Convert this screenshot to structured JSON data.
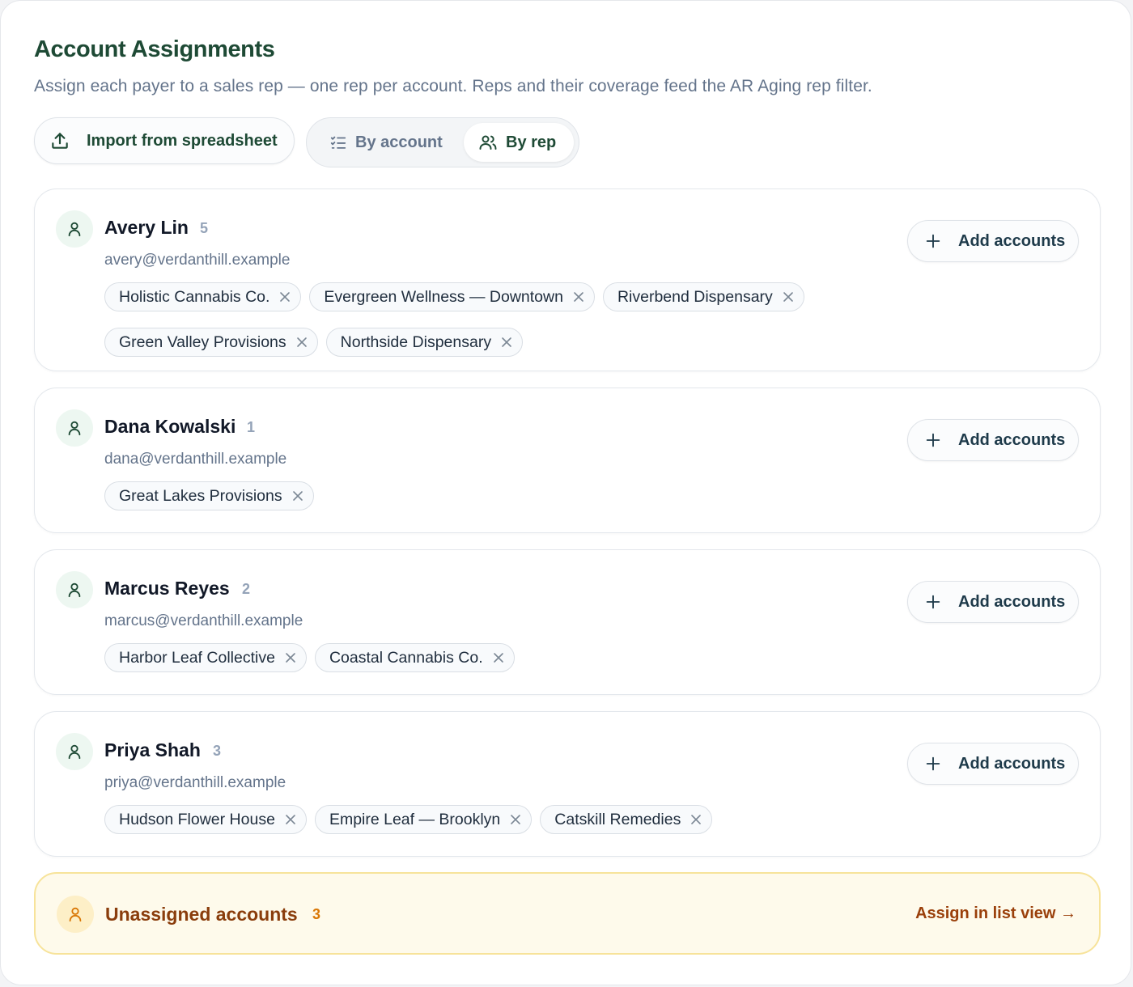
{
  "header": {
    "title": "Account Assignments",
    "subtitle": "Assign each payer to a sales rep — one rep per account. Reps and their coverage feed the AR Aging rep filter."
  },
  "toolbar": {
    "import_label": "Import from spreadsheet",
    "view_toggle": {
      "by_account_label": "By account",
      "by_rep_label": "By rep",
      "selected": "By rep"
    }
  },
  "reps": [
    {
      "name": "Avery Lin",
      "count": "5",
      "email": "avery@verdanthill.example",
      "add_label": "Add accounts",
      "accounts": [
        "Holistic Cannabis Co.",
        "Evergreen Wellness — Downtown",
        "Riverbend Dispensary",
        "Green Valley Provisions",
        "Northside Dispensary"
      ]
    },
    {
      "name": "Dana Kowalski",
      "count": "1",
      "email": "dana@verdanthill.example",
      "add_label": "Add accounts",
      "accounts": [
        "Great Lakes Provisions"
      ]
    },
    {
      "name": "Marcus Reyes",
      "count": "2",
      "email": "marcus@verdanthill.example",
      "add_label": "Add accounts",
      "accounts": [
        "Harbor Leaf Collective",
        "Coastal Cannabis Co."
      ]
    },
    {
      "name": "Priya Shah",
      "count": "3",
      "email": "priya@verdanthill.example",
      "add_label": "Add accounts",
      "accounts": [
        "Hudson Flower House",
        "Empire Leaf — Brooklyn",
        "Catskill Remedies"
      ]
    }
  ],
  "unassigned": {
    "label": "Unassigned accounts",
    "count": "3",
    "link_label": "Assign in list view →"
  },
  "colors": {
    "brand_green": "#1e4a35",
    "warning_bg": "#fefaeb",
    "warning_border": "#f7e39a",
    "warning_text": "#8a3d0c",
    "warning_accent": "#d97706"
  },
  "icons": {
    "import": "upload-icon",
    "by_account": "checklist-icon",
    "by_rep": "users-icon",
    "rep_avatar": "user-icon",
    "add": "plus-icon",
    "remove_chip": "close-icon"
  }
}
